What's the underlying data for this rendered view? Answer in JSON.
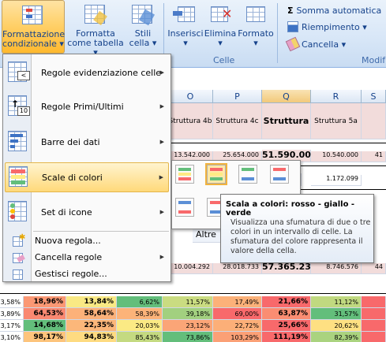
{
  "ribbon": {
    "formattazione": {
      "line1": "Formattazione",
      "line2": "condizionale"
    },
    "formatta_tabella": {
      "line1": "Formatta",
      "line2": "come tabella"
    },
    "stili_cella": {
      "line1": "Stili",
      "line2": "cella"
    },
    "inserisci": "Inserisci",
    "elimina": "Elimina",
    "formato": "Formato",
    "celle_group": "Celle",
    "somma_automatica": "Somma automatica",
    "riempimento": "Riempimento",
    "cancella": "Cancella",
    "modifica_group": "Modif",
    "dropdown_glyph": "▾",
    "sigma": "Σ"
  },
  "columns": [
    "O",
    "P",
    "Q",
    "R",
    "S"
  ],
  "header_cells": [
    "Struttura 4b",
    "Struttura 4c",
    "Struttura 5",
    "Struttura 5a",
    ""
  ],
  "rows": [
    {
      "o": "13.542.000",
      "p": "25.654.000",
      "q": "51.590.000",
      "r": "10.540.000",
      "s": "41"
    },
    {
      "o": "",
      "p": "",
      "q": "72",
      "r": "1.172.099",
      "s": ""
    },
    {
      "o": "10.004.292",
      "p": "28.018.733",
      "q": "57.365.235",
      "r": "8.746.576",
      "s": "44"
    }
  ],
  "altre_label": "Altre",
  "percent_rows": [
    [
      "3,58%",
      "18,96%",
      "13,84%",
      "6,62%",
      "11,57%",
      "17,49%",
      "21,66%",
      "11,12%",
      ""
    ],
    [
      "3,89%",
      "64,53%",
      "58,64%",
      "58,39%",
      "39,18%",
      "69,00%",
      "63,87%",
      "31,57%",
      ""
    ],
    [
      "3,17%",
      "14,68%",
      "22,35%",
      "20,03%",
      "23,12%",
      "22,72%",
      "25,66%",
      "20,62%",
      ""
    ],
    [
      "3,10%",
      "98,17%",
      "94,83%",
      "85,43%",
      "73,86%",
      "103,29%",
      "111,19%",
      "82,39%",
      ""
    ]
  ],
  "menu": {
    "items": [
      {
        "label": "Regole evidenziazione celle",
        "arrow": "▶"
      },
      {
        "label": "Regole Primi/Ultimi",
        "arrow": "▶"
      },
      {
        "label": "Barre dei dati",
        "arrow": "▶"
      },
      {
        "label": "Scale di colori",
        "arrow": "▶"
      },
      {
        "label": "Set di icone",
        "arrow": "▶"
      }
    ],
    "nuova_regola": "Nuova regola...",
    "cancella_regole": "Cancella regole",
    "cancella_arrow": "▶",
    "gestisci_regole": "Gestisci regole..."
  },
  "tooltip": {
    "title": "Scala a colori: rosso - giallo - verde",
    "text": "Visualizza una sfumatura di due o tre colori in un intervallo di celle. La sfumatura del colore rappresenta il valore della cella."
  },
  "colors": {
    "menu_highlight": "#ffd97a",
    "red": "#f8696b",
    "yellow": "#ffeb84",
    "green": "#63be7b",
    "header_pink": "#f2dcdb"
  }
}
